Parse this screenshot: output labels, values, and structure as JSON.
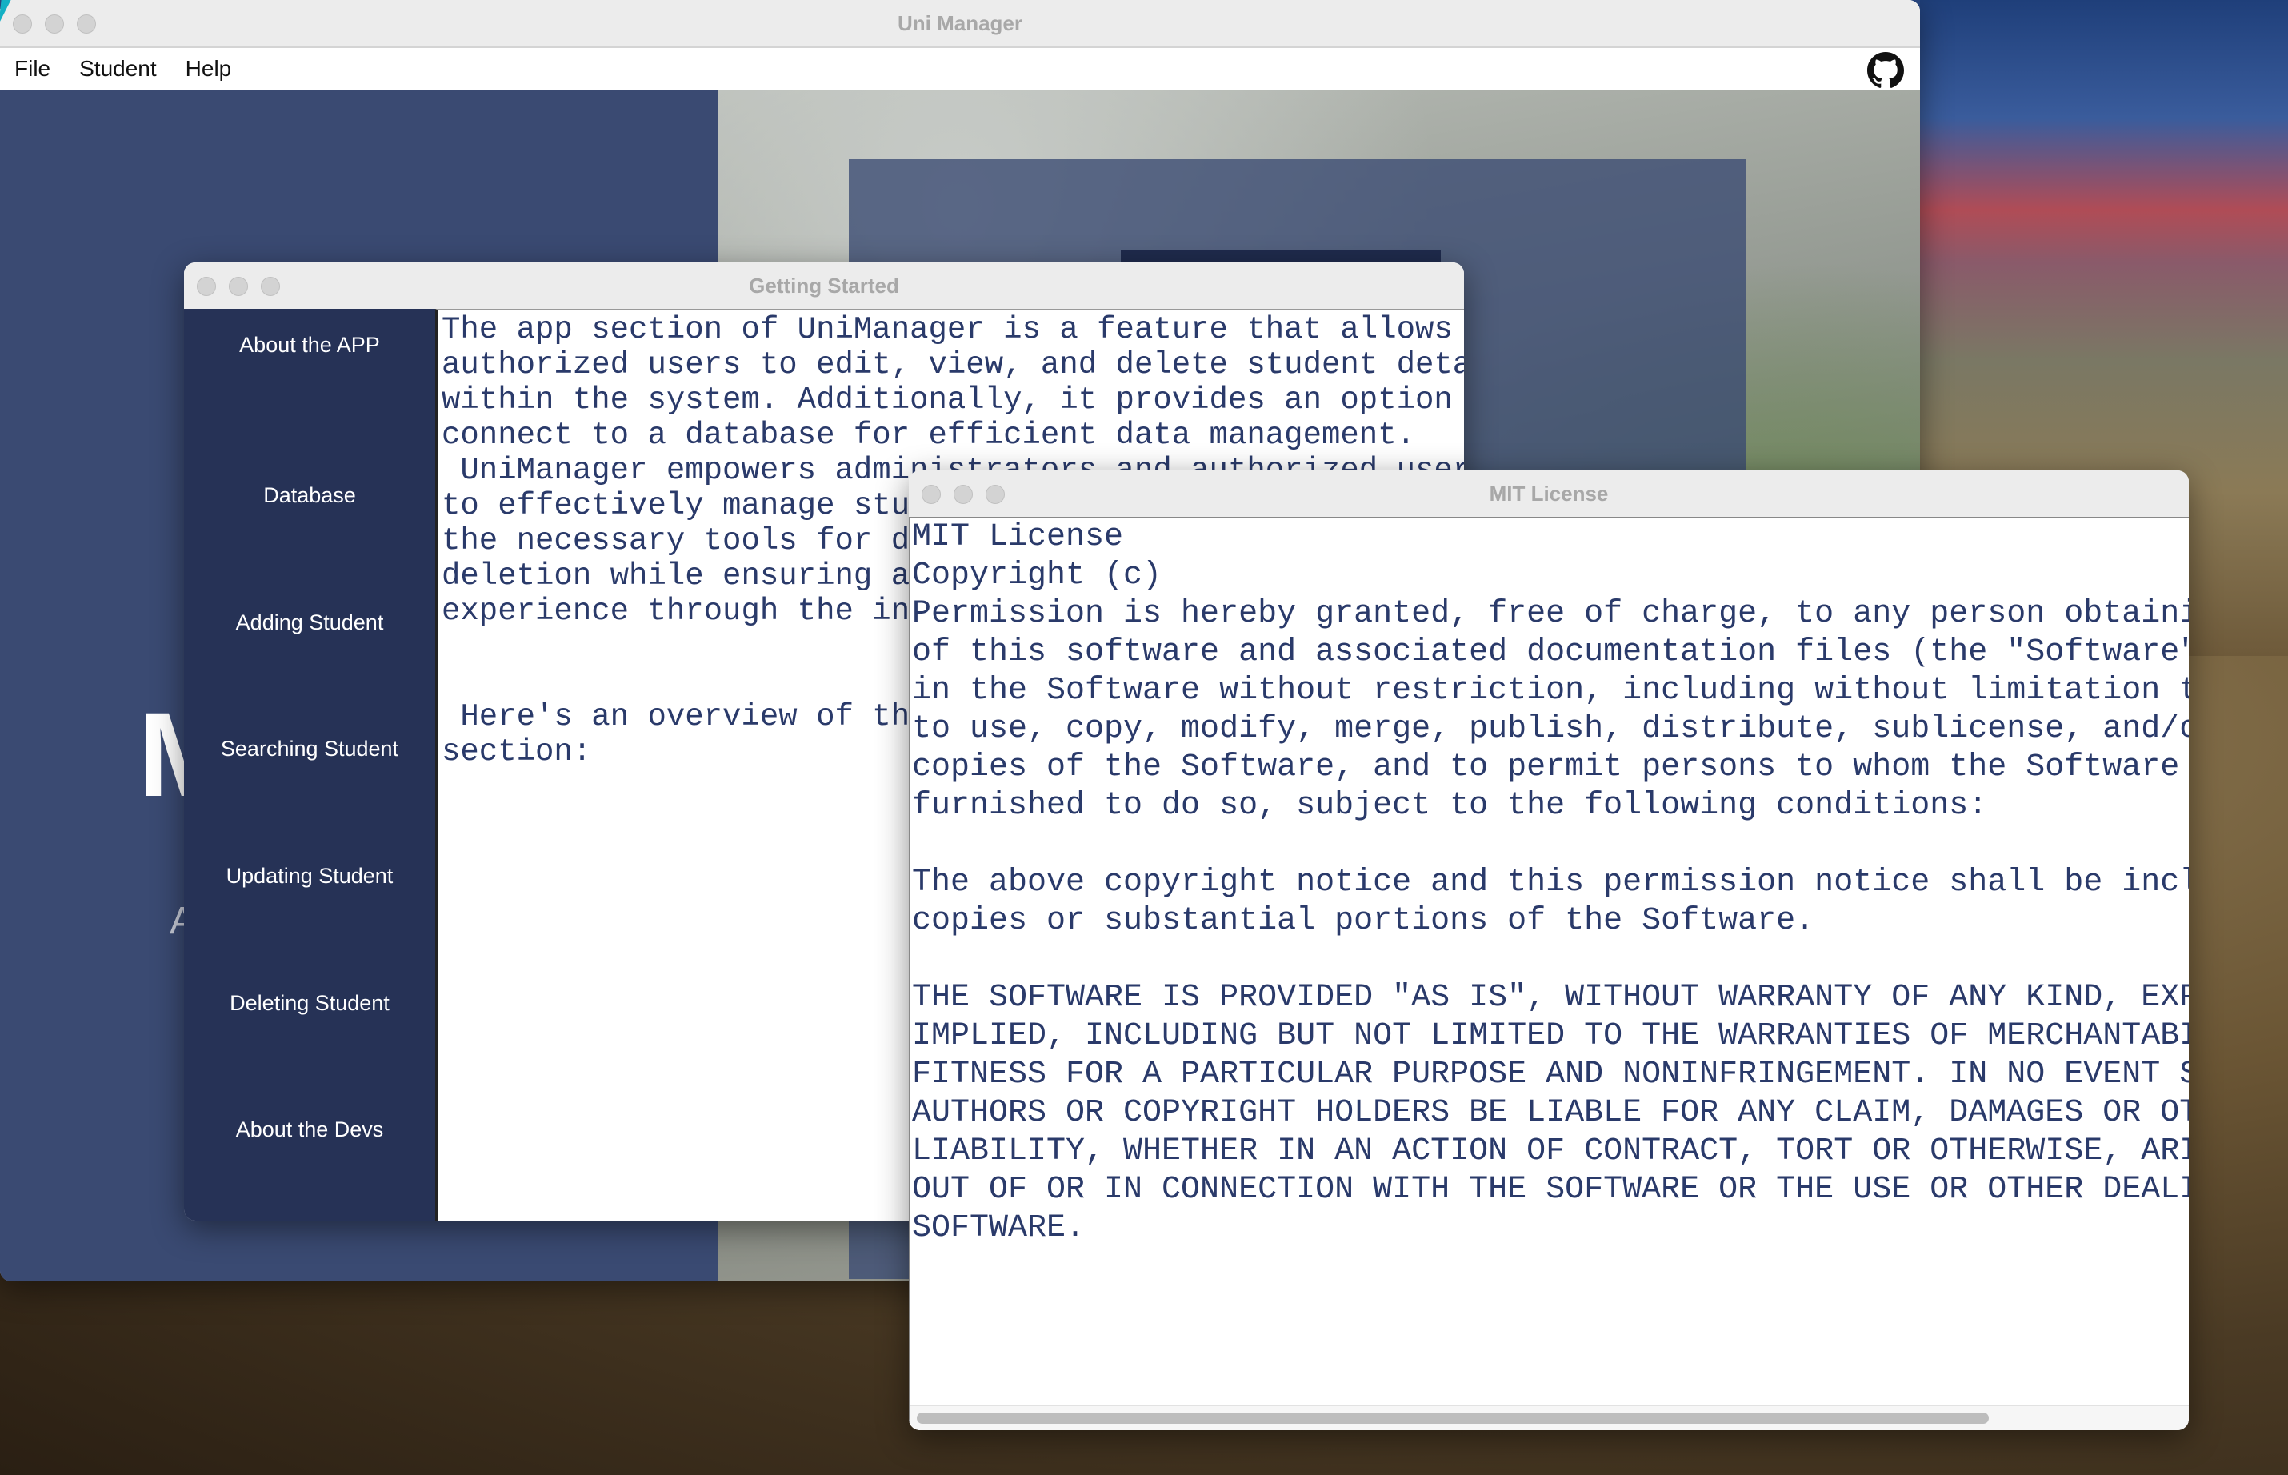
{
  "main_window": {
    "title": "Uni Manager",
    "menu": [
      "File",
      "Student",
      "Help"
    ],
    "hero_letter": "M",
    "hero_sub": "A"
  },
  "getting_started": {
    "title": "Getting Started",
    "nav": [
      "About the APP",
      "Database",
      "Adding Student",
      "Searching Student",
      "Updating Student",
      "Deleting Student",
      "About the Devs"
    ],
    "text": "The app section of UniManager is a feature that allows\nauthorized users to edit, view, and delete student details\nwithin the system. Additionally, it provides an option to\nconnect to a database for efficient data management.\n UniManager empowers administrators and authorized users\nto effectively manage stude\nthe necessary tools for dat\ndeletion while ensuring a s\nexperience through the inte\n\n\n Here's an overview of the\nsection:"
  },
  "mit_license": {
    "title": "MIT License",
    "text": "MIT License\nCopyright (c)\nPermission is hereby granted, free of charge, to any person obtaini\nof this software and associated documentation files (the \"Software\"\nin the Software without restriction, including without limitation t\nto use, copy, modify, merge, publish, distribute, sublicense, and/o\ncopies of the Software, and to permit persons to whom the Software\nfurnished to do so, subject to the following conditions:\n\nThe above copyright notice and this permission notice shall be incl\ncopies or substantial portions of the Software.\n\nTHE SOFTWARE IS PROVIDED \"AS IS\", WITHOUT WARRANTY OF ANY KIND, EXP\nIMPLIED, INCLUDING BUT NOT LIMITED TO THE WARRANTIES OF MERCHANTABI\nFITNESS FOR A PARTICULAR PURPOSE AND NONINFRINGEMENT. IN NO EVENT S\nAUTHORS OR COPYRIGHT HOLDERS BE LIABLE FOR ANY CLAIM, DAMAGES OR OT\nLIABILITY, WHETHER IN AN ACTION OF CONTRACT, TORT OR OTHERWISE, ARI\nOUT OF OR IN CONNECTION WITH THE SOFTWARE OR THE USE OR OTHER DEALI\nSOFTWARE."
  },
  "icons": {
    "github": "github-icon"
  },
  "colors": {
    "sidebar": "#263256",
    "main_panel": "#3a4a72",
    "license_text": "#2a3a6a"
  }
}
